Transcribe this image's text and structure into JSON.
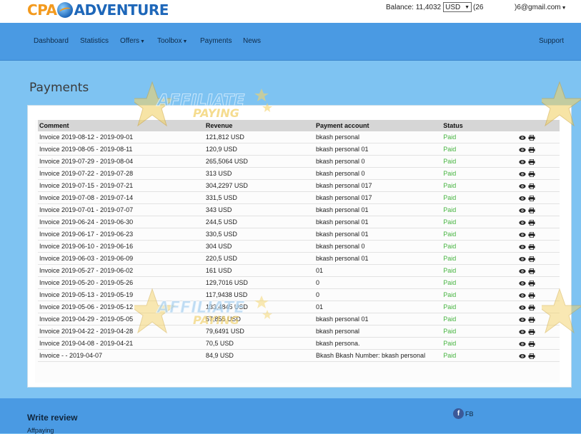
{
  "header": {
    "logo_part1": "CPA",
    "logo_part2": "ADVENTURE",
    "balance_label": "Balance: 11,4032",
    "currency": "USD",
    "phone": "(26",
    "email": ")6@gmail.com"
  },
  "nav": {
    "items": [
      {
        "label": "Dashboard"
      },
      {
        "label": "Statistics"
      },
      {
        "label": "Offers"
      },
      {
        "label": "Toolbox"
      },
      {
        "label": "Payments"
      },
      {
        "label": "News"
      }
    ],
    "support": "Support"
  },
  "page": {
    "title": "Payments"
  },
  "table": {
    "headers": [
      "Comment",
      "Revenue",
      "Payment account",
      "Status"
    ],
    "rows": [
      {
        "comment": "Invoice 2019-08-12 - 2019-09-01",
        "revenue": "121,812 USD",
        "account": "bkash personal",
        "status": "Paid"
      },
      {
        "comment": "Invoice 2019-08-05 - 2019-08-11",
        "revenue": "120,9 USD",
        "account": "bkash personal 01",
        "status": "Paid"
      },
      {
        "comment": "Invoice 2019-07-29 - 2019-08-04",
        "revenue": "265,5064 USD",
        "account": "bkash personal 0",
        "status": "Paid"
      },
      {
        "comment": "Invoice 2019-07-22 - 2019-07-28",
        "revenue": "313 USD",
        "account": "bkash personal 0",
        "status": "Paid"
      },
      {
        "comment": "Invoice 2019-07-15 - 2019-07-21",
        "revenue": "304,2297 USD",
        "account": "bkash personal 017",
        "status": "Paid"
      },
      {
        "comment": "Invoice 2019-07-08 - 2019-07-14",
        "revenue": "331,5 USD",
        "account": "bkash personal 017",
        "status": "Paid"
      },
      {
        "comment": "Invoice 2019-07-01 - 2019-07-07",
        "revenue": "343 USD",
        "account": "bkash personal 01",
        "status": "Paid"
      },
      {
        "comment": "Invoice 2019-06-24 - 2019-06-30",
        "revenue": "244,5 USD",
        "account": "bkash personal 01",
        "status": "Paid"
      },
      {
        "comment": "Invoice 2019-06-17 - 2019-06-23",
        "revenue": "330,5 USD",
        "account": "bkash personal 01",
        "status": "Paid"
      },
      {
        "comment": "Invoice 2019-06-10 - 2019-06-16",
        "revenue": "304 USD",
        "account": "bkash personal 0",
        "status": "Paid"
      },
      {
        "comment": "Invoice 2019-06-03 - 2019-06-09",
        "revenue": "220,5 USD",
        "account": "bkash personal 01",
        "status": "Paid"
      },
      {
        "comment": "Invoice 2019-05-27 - 2019-06-02",
        "revenue": "161 USD",
        "account": "01",
        "status": "Paid"
      },
      {
        "comment": "Invoice 2019-05-20 - 2019-05-26",
        "revenue": "129,7016 USD",
        "account": "0",
        "status": "Paid"
      },
      {
        "comment": "Invoice 2019-05-13 - 2019-05-19",
        "revenue": "117,9438 USD",
        "account": "0",
        "status": "Paid"
      },
      {
        "comment": "Invoice 2019-05-06 - 2019-05-12",
        "revenue": "133,4845 USD",
        "account": "01",
        "status": "Paid"
      },
      {
        "comment": "Invoice 2019-04-29 - 2019-05-05",
        "revenue": "57,855 USD",
        "account": "bkash personal 01",
        "status": "Paid"
      },
      {
        "comment": "Invoice 2019-04-22 - 2019-04-28",
        "revenue": "79,6491 USD",
        "account": "bkash personal",
        "status": "Paid"
      },
      {
        "comment": "Invoice 2019-04-08 - 2019-04-21",
        "revenue": "70,5 USD",
        "account": "bkash persona.",
        "status": "Paid"
      },
      {
        "comment": "Invoice - - 2019-04-07",
        "revenue": "84,9 USD",
        "account": "Bkash Bkash Number: bkash personal",
        "status": "Paid"
      }
    ]
  },
  "watermark": {
    "line1": "AFFILIATE",
    "line2": "PAYING"
  },
  "footer": {
    "title": "Write review",
    "subtitle": "Affpaying",
    "fb_label": "FB"
  },
  "colors": {
    "background": "#7ec3f2",
    "navbar": "#4a9ae3",
    "paid": "#46b440"
  }
}
